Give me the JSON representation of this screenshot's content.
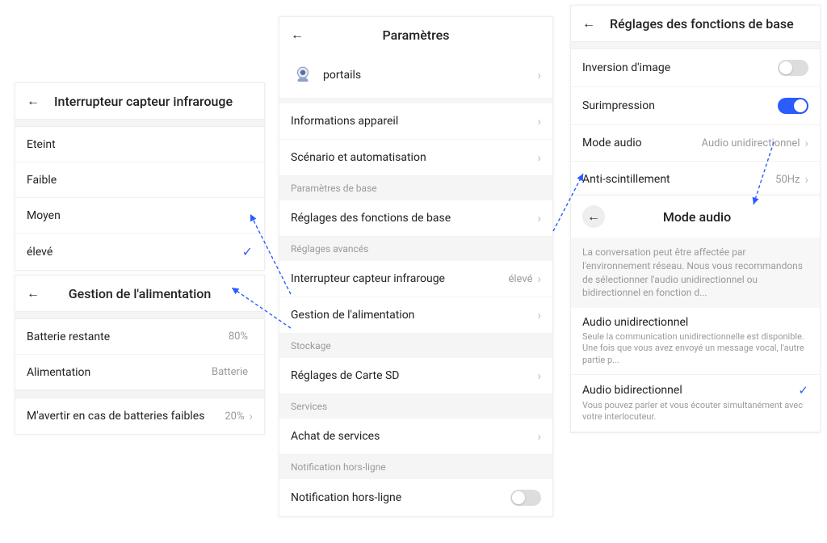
{
  "irPanel": {
    "title": "Interrupteur capteur infrarouge",
    "options": [
      "Eteint",
      "Faible",
      "Moyen",
      "élevé"
    ],
    "selected": "élevé"
  },
  "pwrPanel": {
    "title": "Gestion de l'alimentation",
    "rows": [
      {
        "label": "Batterie restante",
        "value": "80%",
        "chev": false
      },
      {
        "label": "Alimentation",
        "value": "Batterie",
        "chev": false
      },
      {
        "label": "M'avertir en cas de batteries faibles",
        "value": "20%",
        "chev": true
      }
    ]
  },
  "mainPanel": {
    "title": "Paramètres",
    "device": {
      "label": "portails"
    },
    "top": [
      {
        "label": "Informations appareil"
      },
      {
        "label": "Scénario et automatisation"
      }
    ],
    "sectBasic": "Paramètres de base",
    "rowsBasic": [
      {
        "label": "Réglages des fonctions de base"
      }
    ],
    "sectAdv": "Réglages avancés",
    "rowsAdv": [
      {
        "label": "Interrupteur capteur infrarouge",
        "value": "élevé"
      },
      {
        "label": "Gestion de l'alimentation"
      }
    ],
    "sectStor": "Stockage",
    "rowsStor": [
      {
        "label": "Réglages de Carte SD"
      }
    ],
    "sectSvc": "Services",
    "rowsSvc": [
      {
        "label": "Achat de services"
      }
    ],
    "sectNotif": "Notification hors-ligne",
    "rowsNotif": [
      {
        "label": "Notification hors-ligne",
        "toggle": false
      }
    ]
  },
  "basicPanel": {
    "title": "Réglages des fonctions de base",
    "rows": [
      {
        "label": "Inversion d'image",
        "toggle": false
      },
      {
        "label": "Surimpression",
        "toggle": true
      },
      {
        "label": "Mode audio",
        "value": "Audio unidirectionnel",
        "chev": true
      },
      {
        "label": "Anti-scintillement",
        "value": "50Hz",
        "chev": true
      }
    ]
  },
  "audioPanel": {
    "title": "Mode audio",
    "desc": "La conversation peut être affectée par l'environnement réseau. Nous vous recommandons de sélectionner l'audio unidirectionnel ou bidirectionnel en fonction d...",
    "options": [
      {
        "title": "Audio unidirectionnel",
        "desc": "Seule la communication unidirectionnelle est disponible. Une fois que vous avez envoyé un message vocal, l'autre partie p...",
        "checked": false
      },
      {
        "title": "Audio bidirectionnel",
        "desc": "Vous pouvez parler et vous écouter simultanément avec votre interlocuteur.",
        "checked": true
      }
    ]
  }
}
